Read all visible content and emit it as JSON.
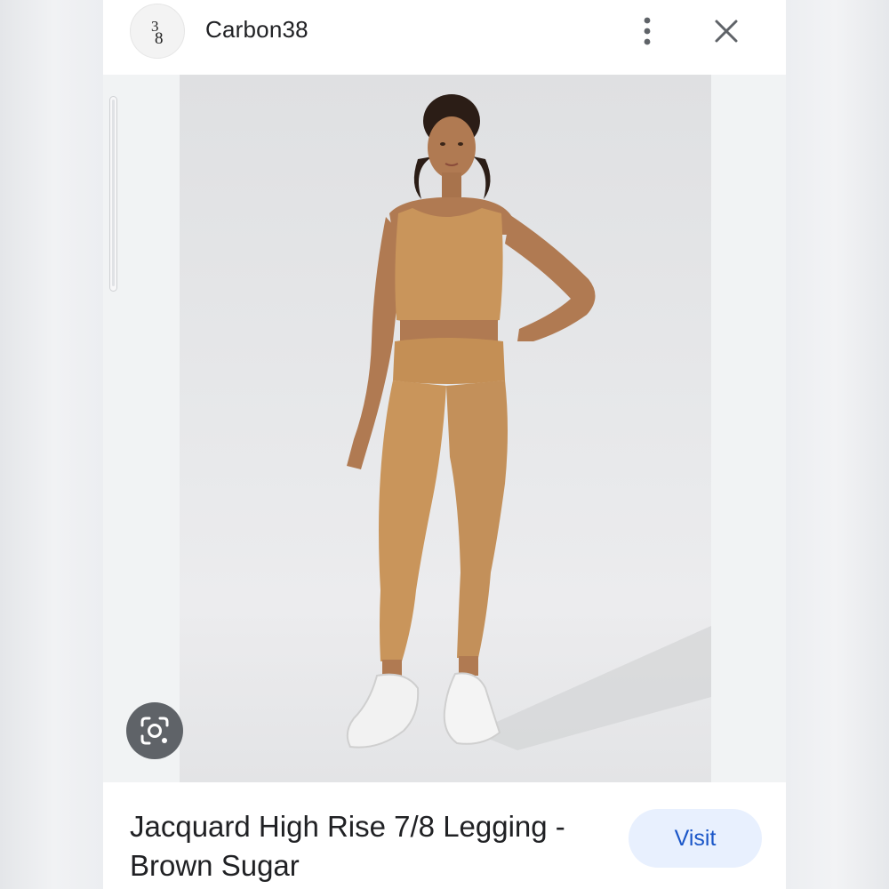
{
  "header": {
    "logo_icon": "carbon38-logo-icon",
    "logo_text": "38",
    "site_name": "Carbon38",
    "menu_icon": "more-vert-icon",
    "close_icon": "close-icon"
  },
  "image": {
    "lens_icon": "google-lens-icon",
    "product_colors": {
      "garment": "#c9955b",
      "skin": "#b07a52",
      "background": "#e6e7e9"
    }
  },
  "footer": {
    "title_line1": "Jacquard High Rise 7/8 Legging -",
    "title_line2": "Brown Sugar",
    "visit_label": "Visit"
  },
  "colors": {
    "accent_text": "#1a56c8",
    "accent_bg": "#e8f0fe",
    "lens_bg": "#5f6368"
  }
}
